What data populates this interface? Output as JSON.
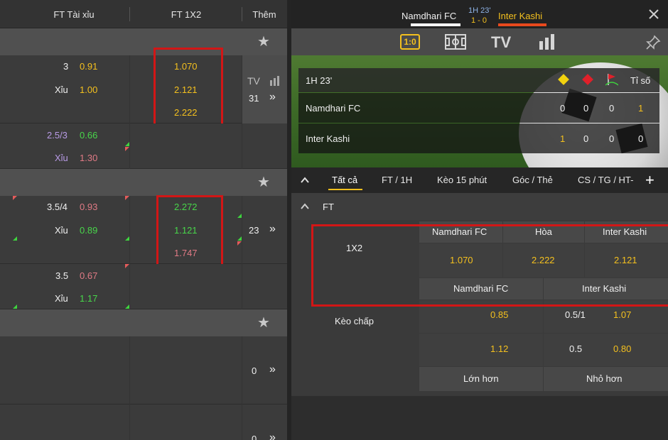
{
  "left": {
    "headers": {
      "tai_xiu": "FT Tài xỉu",
      "ft1x2": "FT 1X2",
      "more": "Thêm"
    },
    "match1": {
      "ou_line1": "3",
      "ou_odd1": "0.91",
      "ou_label2": "Xỉu",
      "ou_odd2": "1.00",
      "x1": "1.070",
      "x2": "2.121",
      "x3": "2.222",
      "tv": "TV",
      "count": "31",
      "sub_line": "2.5/3",
      "sub_odd1": "0.66",
      "sub_label": "Xỉu",
      "sub_odd2": "1.30"
    },
    "match2": {
      "ou_line1": "3.5/4",
      "ou_odd1": "0.93",
      "ou_label2": "Xỉu",
      "ou_odd2": "0.89",
      "x1": "2.272",
      "x2": "1.121",
      "x3": "1.747",
      "count": "23",
      "sub_line": "3.5",
      "sub_odd1": "0.67",
      "sub_label": "Xỉu",
      "sub_odd2": "1.17"
    },
    "match3": {
      "count": "0"
    },
    "match4": {
      "count": "0"
    },
    "arrow": "»"
  },
  "right": {
    "home": "Namdhari FC",
    "away": "Inter Kashi",
    "time": "1H 23'",
    "score": "1 - 0",
    "home_color": "#ffffff",
    "away_color": "#e8491d",
    "icons": {
      "score_icon": "1:0",
      "tv": "TV"
    },
    "scoreboard": {
      "time": "1H 23'",
      "score_label": "Tỉ số",
      "rows": [
        {
          "team": "Namdhari FC",
          "yc": "0",
          "rc": "0",
          "corner": "0",
          "score": "1"
        },
        {
          "team": "Inter Kashi",
          "yc": "1",
          "rc": "0",
          "corner": "0",
          "score": "0"
        }
      ]
    },
    "tabs": [
      "Tất cả",
      "FT / 1H",
      "Kèo 15 phút",
      "Góc / Thẻ",
      "CS / TG / HT-"
    ],
    "ft_label": "FT",
    "market_1x2": {
      "label": "1X2",
      "cols": [
        "Namdhari FC",
        "Hòa",
        "Inter Kashi"
      ],
      "odds": [
        "1.070",
        "2.222",
        "2.121"
      ]
    },
    "handicap": {
      "cols": [
        "Namdhari FC",
        "Inter Kashi"
      ],
      "label": "Kèo chấp",
      "row1": {
        "home": "0.85",
        "line": "0.5/1",
        "away": "1.07"
      },
      "row2": {
        "home": "1.12",
        "line": "0.5",
        "away": "0.80"
      },
      "foot": [
        "Lớn hơn",
        "Nhỏ hơn"
      ]
    }
  }
}
